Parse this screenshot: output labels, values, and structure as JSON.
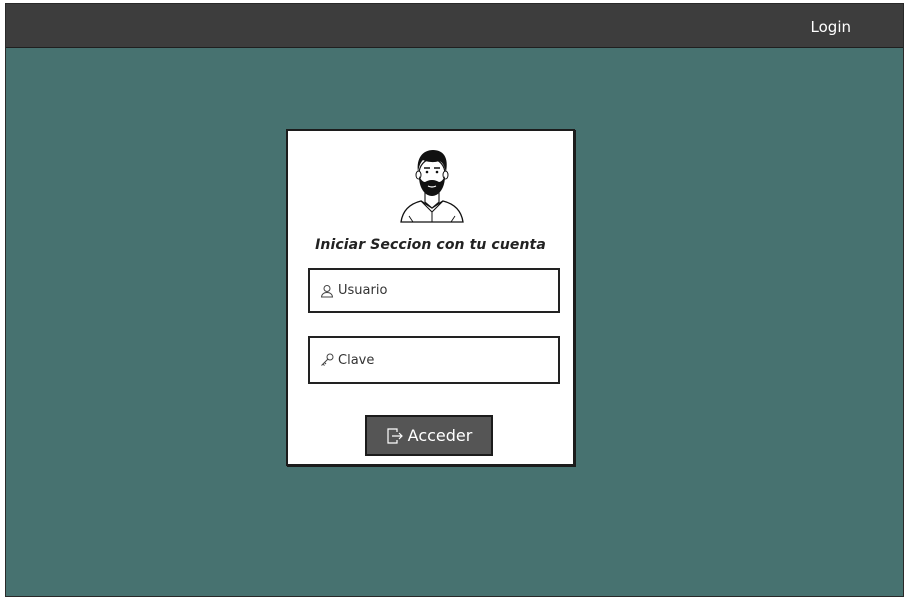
{
  "header": {
    "login_label": "Login"
  },
  "login_card": {
    "title": "Iniciar Seccion con tu  cuenta",
    "user_field": {
      "placeholder": "Usuario",
      "icon": "user-icon"
    },
    "password_field": {
      "placeholder": "Clave",
      "icon": "key-icon"
    },
    "submit_button": {
      "label": "Acceder",
      "icon": "sign-in-icon"
    },
    "avatar_icon": "bearded-man-avatar"
  },
  "colors": {
    "background": "#477270",
    "topbar": "#3d3d3d",
    "button": "#555555",
    "card": "#ffffff"
  }
}
